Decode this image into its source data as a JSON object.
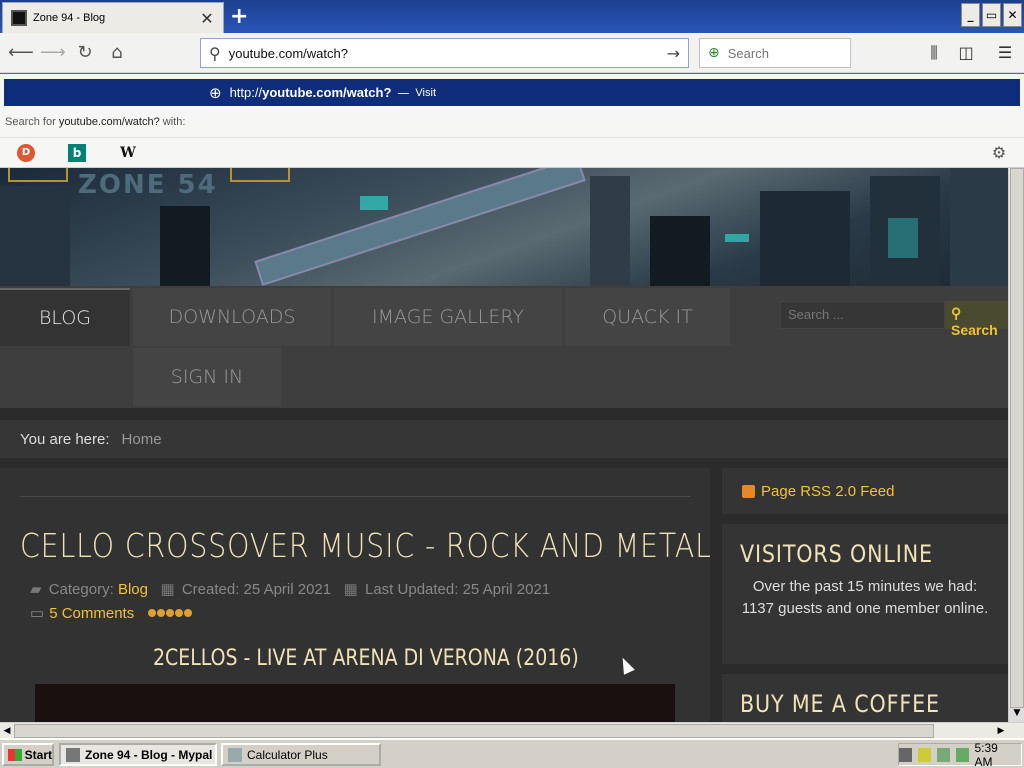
{
  "browser": {
    "tab_title": "Zone 94 - Blog",
    "tab_close": "✕",
    "new_tab": "+",
    "url_value": "youtube.com/watch?",
    "search_placeholder": "Search",
    "window_buttons": {
      "minimize": "_",
      "restore": "▭",
      "close": "✕"
    }
  },
  "dropdown": {
    "url_prefix": "http://",
    "url_bold": "youtube.com/",
    "url_rest": "watch?",
    "dash": "—",
    "visit": "Visit",
    "search_for_pre": "Search for ",
    "search_for_term": "youtube.com/watch?",
    "search_for_post": " with:",
    "engines": [
      "DuckDuckGo",
      "Bing",
      "Wikipedia"
    ]
  },
  "site": {
    "logo_text": "ZONE 54",
    "menu": [
      "BLOG",
      "DOWNLOADS",
      "IMAGE GALLERY",
      "QUACK IT",
      "SIGN IN"
    ],
    "search_placeholder": "Search ...",
    "search_button": "Search",
    "breadcrumb_label": "You are here:",
    "breadcrumb_home": "Home"
  },
  "article": {
    "title": "CELLO CROSSOVER MUSIC - ROCK AND METAL",
    "category_label": "Category:",
    "category": "Blog",
    "created": "Created: 25 April 2021",
    "updated": "Last Updated: 25 April 2021",
    "comments": "5 Comments",
    "rating": 5,
    "subtitle": "2CELLOS - LIVE AT ARENA DI VERONA (2016)"
  },
  "sidebar": {
    "rss": "Page RSS 2.0 Feed",
    "visitors_title": "VISITORS ONLINE",
    "visitors_text": "Over the past 15 minutes we had: 1137 guests and one member online.",
    "coffee_title": "BUY ME A COFFEE"
  },
  "taskbar": {
    "start": "Start",
    "items": [
      "Zone 94 - Blog - Mypal",
      "Calculator Plus"
    ],
    "clock": "5:39 AM"
  },
  "colors": {
    "accent": "#f1c232",
    "heading": "#f0e2b6",
    "dropdown_bg": "#0f2d7a"
  }
}
